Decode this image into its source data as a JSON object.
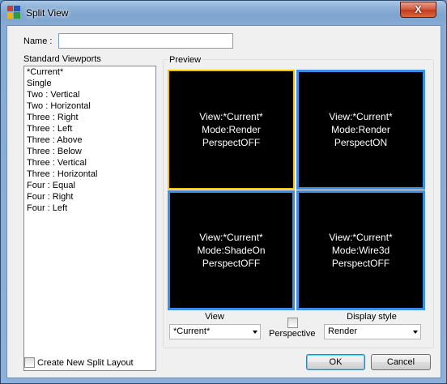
{
  "window": {
    "title": "Split View",
    "close_label": "X"
  },
  "name_field": {
    "label": "Name :",
    "value": ""
  },
  "viewports": {
    "label": "Standard Viewports",
    "items": [
      "*Current*",
      "Single",
      "Two : Vertical",
      "Two : Horizontal",
      "Three : Right",
      "Three : Left",
      "Three : Above",
      "Three : Below",
      "Three : Vertical",
      "Three : Horizontal",
      "Four : Equal",
      "Four : Right",
      "Four : Left"
    ]
  },
  "preview": {
    "label": "Preview",
    "panes": [
      {
        "view": "View:*Current*",
        "mode": "Mode:Render",
        "persp": "PerspectOFF"
      },
      {
        "view": "View:*Current*",
        "mode": "Mode:Render",
        "persp": "PerspectON"
      },
      {
        "view": "View:*Current*",
        "mode": "Mode:ShadeOn",
        "persp": "PerspectOFF"
      },
      {
        "view": "View:*Current*",
        "mode": "Mode:Wire3d",
        "persp": "PerspectOFF"
      }
    ]
  },
  "controls": {
    "view_label": "View",
    "view_value": "*Current*",
    "perspective_label": "Perspective",
    "display_style_label": "Display style",
    "display_style_value": "Render"
  },
  "footer": {
    "create_label": "Create New Split Layout",
    "ok_label": "OK",
    "cancel_label": "Cancel"
  }
}
